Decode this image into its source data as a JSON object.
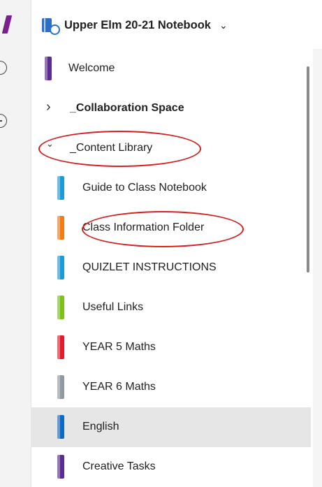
{
  "notebook": {
    "title": "Upper Elm 20-21 Notebook",
    "chevron": "⌄"
  },
  "sections": [
    {
      "label": "Welcome",
      "color": "#5c2d91",
      "kind": "section"
    },
    {
      "label": "_Collaboration Space",
      "kind": "group",
      "chevron": "›"
    },
    {
      "label": "_Content Library",
      "kind": "group-open",
      "chevron": "⌄"
    },
    {
      "label": "Guide to Class Notebook",
      "color": "#1e9bd7",
      "kind": "section"
    },
    {
      "label": "Class Information Folder",
      "color": "#f07c1a",
      "kind": "section"
    },
    {
      "label": "QUIZLET INSTRUCTIONS",
      "color": "#1e9bd7",
      "kind": "section"
    },
    {
      "label": "Useful Links",
      "color": "#7cc11c",
      "kind": "section"
    },
    {
      "label": "YEAR 5 Maths",
      "color": "#e01d2d",
      "kind": "section"
    },
    {
      "label": "YEAR 6 Maths",
      "color": "#8f9aa0",
      "kind": "section"
    },
    {
      "label": "English",
      "color": "#1068c0",
      "kind": "section",
      "selected": true
    },
    {
      "label": "Creative Tasks",
      "color": "#5c2d91",
      "kind": "section"
    }
  ],
  "annotation_color": "#d42020"
}
